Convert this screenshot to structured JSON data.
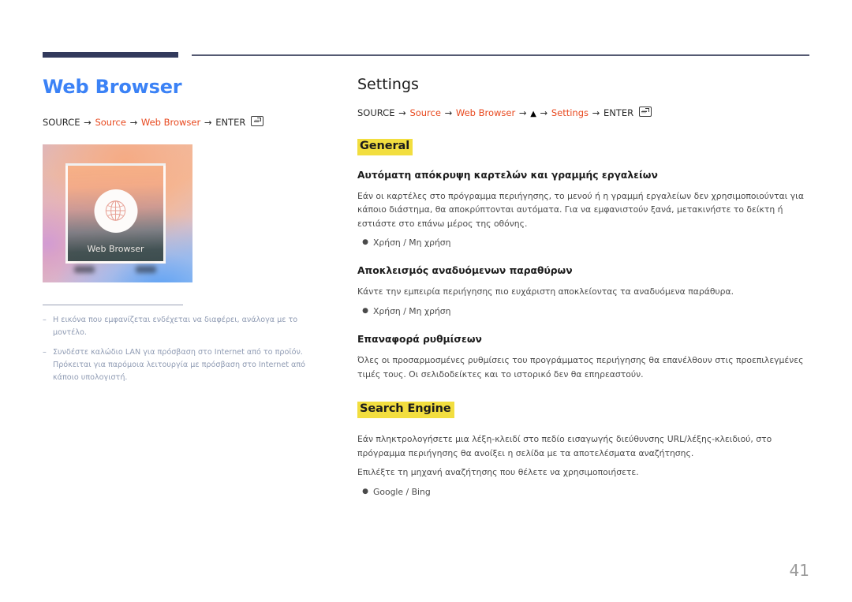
{
  "page": {
    "number": "41"
  },
  "left": {
    "title": "Web Browser",
    "breadcrumb": {
      "start": "SOURCE",
      "arrow": "→",
      "step1": "Source",
      "step2": "Web Browser",
      "enter": "ENTER",
      "enter_icon": "enter-key-icon"
    },
    "thumbnail": {
      "label": "Web Browser",
      "icon": "globe-icon"
    },
    "footnotes": [
      {
        "marker": "–",
        "text": "Η εικόνα που εμφανίζεται ενδέχεται να διαφέρει, ανάλογα με το μοντέλο."
      },
      {
        "marker": "–",
        "text": "Συνδέστε καλώδιο LAN για πρόσβαση στο Internet από το προϊόν. Πρόκειται για παρόμοια λειτουργία με πρόσβαση στο Internet από κάποιο υπολογιστή."
      }
    ]
  },
  "right": {
    "title": "Settings",
    "breadcrumb": {
      "start": "SOURCE",
      "arrow": "→",
      "step1": "Source",
      "step2": "Web Browser",
      "triangle": "▲",
      "step3": "Settings",
      "enter": "ENTER",
      "enter_icon": "enter-key-icon"
    },
    "sections": [
      {
        "heading": "General",
        "blocks": [
          {
            "sub": "Αυτόματη απόκρυψη καρτελών και γραμμής εργαλείων",
            "paras": [
              "Εάν οι καρτέλες στο πρόγραμμα περιήγησης, το μενού ή η γραμμή εργαλείων δεν χρησιμοποιούνται για κάποιο διάστημα, θα αποκρύπτονται αυτόματα. Για να εμφανιστούν ξανά, μετακινήστε το δείκτη ή εστιάστε στο επάνω μέρος της οθόνης."
            ],
            "bullets": [
              "Χρήση / Μη χρήση"
            ]
          },
          {
            "sub": "Αποκλεισμός αναδυόμενων παραθύρων",
            "paras": [
              "Κάντε την εμπειρία περιήγησης πιο ευχάριστη αποκλείοντας τα αναδυόμενα παράθυρα."
            ],
            "bullets": [
              "Χρήση / Μη χρήση"
            ]
          },
          {
            "sub": "Επαναφορά ρυθμίσεων",
            "paras": [
              "Όλες οι προσαρμοσμένες ρυθμίσεις του προγράμματος περιήγησης θα επανέλθουν στις προεπιλεγμένες τιμές τους. Οι σελιδοδείκτες και το ιστορικό δεν θα επηρεαστούν."
            ],
            "bullets": []
          }
        ]
      },
      {
        "heading": "Search Engine",
        "blocks": [
          {
            "sub": "",
            "paras": [
              "Εάν πληκτρολογήσετε μια λέξη-κλειδί στο πεδίο εισαγωγής διεύθυνσης URL/λέξης-κλειδιού, στο πρόγραμμα περιήγησης θα ανοίξει η σελίδα με τα αποτελέσματα αναζήτησης.",
              "Επιλέξτε τη μηχανή αναζήτησης που θέλετε να χρησιμοποιήσετε."
            ],
            "bullets": [
              "Google / Bing"
            ]
          }
        ]
      }
    ]
  },
  "colors": {
    "title_blue": "#3b82f6",
    "accent_red": "#e8491f",
    "highlight_yellow": "#f2de3f",
    "rule_navy": "#323a5c",
    "footnote_gray": "#8f9bb3"
  }
}
